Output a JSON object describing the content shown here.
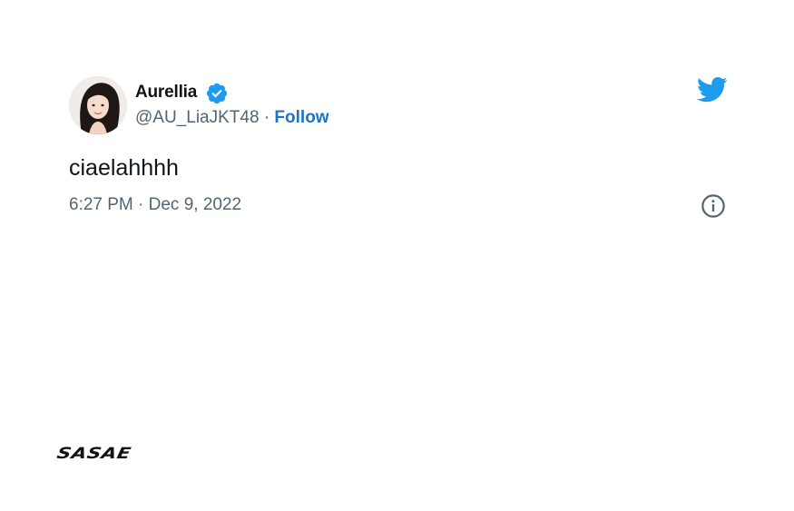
{
  "tweet": {
    "author_name": "Aurellia",
    "handle": "@AU_LiaJKT48",
    "separator": "·",
    "follow_label": "Follow",
    "text": "ciaelahhhh",
    "timestamp": "6:27 PM · Dec 9, 2022"
  },
  "icons": {
    "verified": "verified-badge-icon",
    "twitter_logo": "twitter-bird-icon",
    "info": "info-icon"
  },
  "branding": {
    "watermark": "SASAE"
  },
  "colors": {
    "follow_link": "#1d74c7",
    "twitter_blue": "#1d9bf0",
    "secondary_text": "#536471",
    "primary_text": "#0f1419"
  }
}
